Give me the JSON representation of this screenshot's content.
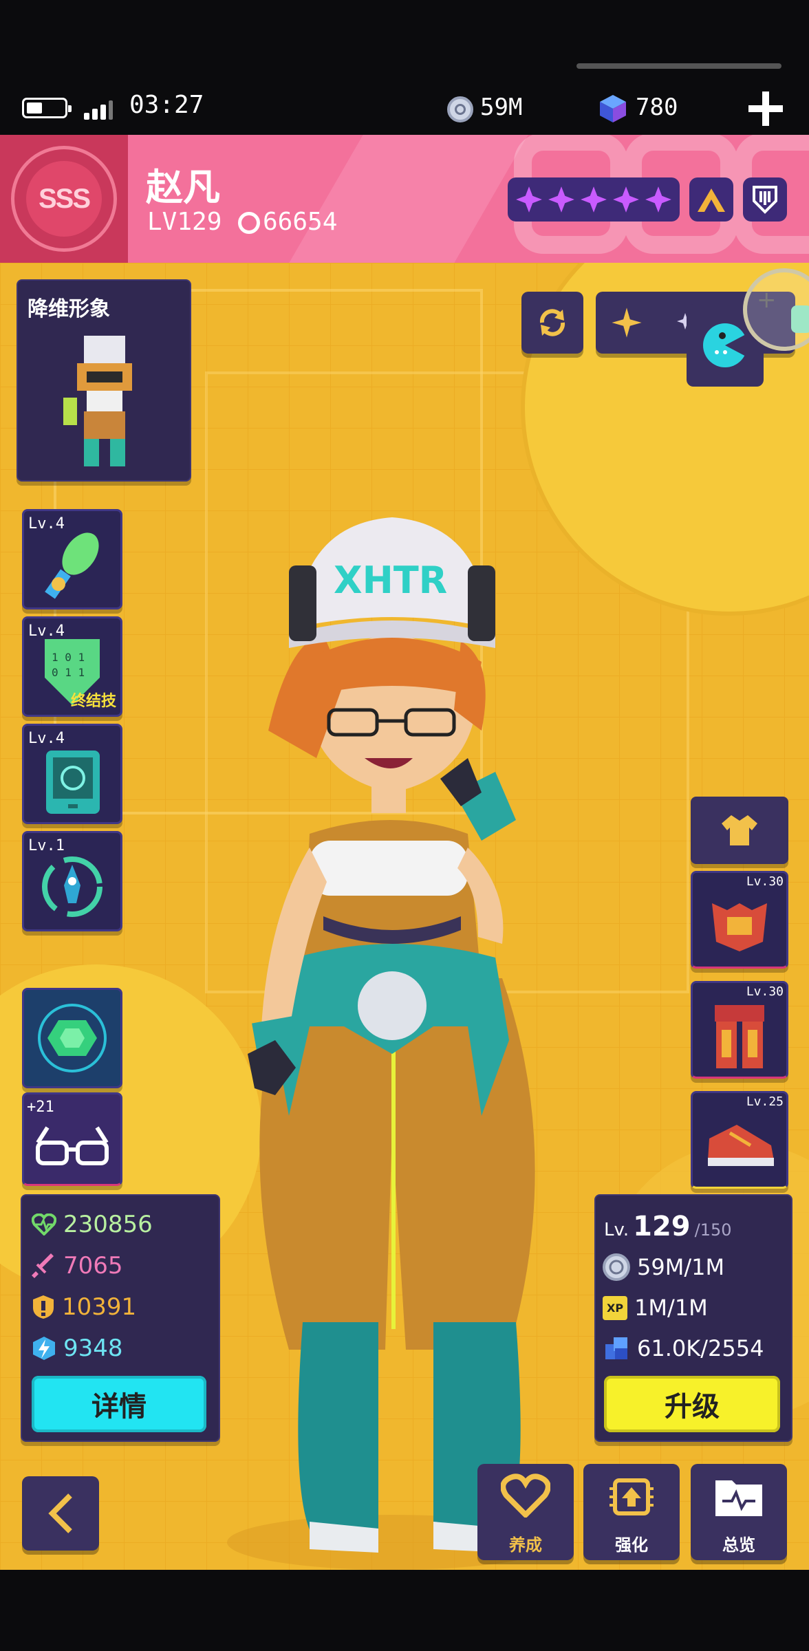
{
  "status": {
    "time": "03:27",
    "coins": "59M",
    "gems": "780"
  },
  "header": {
    "rank_badge": "SSS",
    "name": "赵凡",
    "level": "LV129",
    "power": "66654",
    "stars": 5
  },
  "portrait_panel": {
    "title": "降维形象"
  },
  "skills": [
    {
      "level": "Lv.4",
      "icon": "energy-sword-icon"
    },
    {
      "level": "Lv.4",
      "icon": "binary-shield-icon",
      "tag": "终结技"
    },
    {
      "level": "Lv.4",
      "icon": "tablet-device-icon"
    },
    {
      "level": "Lv.1",
      "icon": "rocket-cycle-icon"
    }
  ],
  "accessories": [
    {
      "icon": "green-gem-icon"
    },
    {
      "icon": "glasses-icon",
      "level": "+21"
    }
  ],
  "equipment": [
    {
      "icon": "shirt-icon"
    },
    {
      "icon": "chest-armor-icon",
      "level": "Lv.30"
    },
    {
      "icon": "leg-armor-icon",
      "level": "Lv.30"
    },
    {
      "icon": "sneaker-icon",
      "level": "Lv.25"
    }
  ],
  "stats": {
    "hp": "230856",
    "attack": "7065",
    "defense": "10391",
    "energy": "9348",
    "detail_button": "详情"
  },
  "upgrade": {
    "lv_label": "Lv.",
    "level": "129",
    "max": "/150",
    "coins": "59M/1M",
    "xp_label": "XP",
    "xp": "1M/1M",
    "cubes": "61.0K/2554",
    "button": "升级"
  },
  "nav": {
    "back": "back",
    "train": "养成",
    "enhance": "强化",
    "overview": "总览"
  },
  "colors": {
    "header": "#f3719b",
    "background": "#f0b72e",
    "panel": "#302851",
    "detail_btn": "#22e4f2",
    "upgrade_btn": "#f7f12a",
    "star": "#c95bff"
  }
}
